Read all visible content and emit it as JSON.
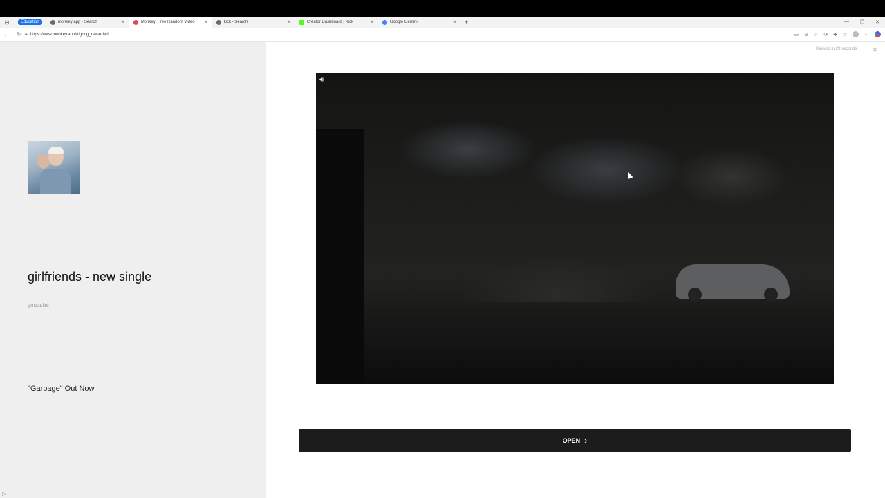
{
  "browser": {
    "tab_group": "Education",
    "tabs": [
      {
        "label": "monkey app - Search",
        "favicon_color": "#6a6a6a",
        "active": false
      },
      {
        "label": "Monkey: Free Random Video",
        "favicon_color": "#e24a4a",
        "active": true
      },
      {
        "label": "kick - Search",
        "favicon_color": "#6a6a6a",
        "active": false
      },
      {
        "label": "Creator Dashboard | Kick",
        "favicon_color": "#53fc18",
        "active": false
      },
      {
        "label": "Google Gemini",
        "favicon_color": "#4285f4",
        "active": false
      }
    ],
    "url": "https://www.monkey.app/#/goog_rewarded"
  },
  "ad": {
    "title": "girlfriends - new single",
    "domain": "youtu.be",
    "description": "\"Garbage\" Out Now",
    "reward_text": "Reward in 29 seconds",
    "open_label": "OPEN"
  }
}
